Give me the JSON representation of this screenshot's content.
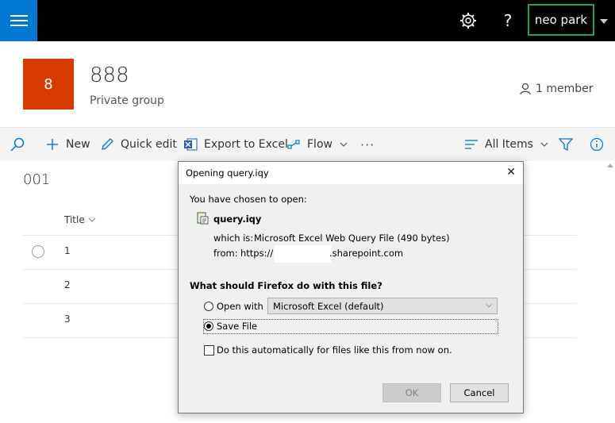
{
  "topbar": {
    "app_launcher_icon": "waffle-icon",
    "settings_icon": "gear-icon",
    "help": "?",
    "user_name": "neo park",
    "user_menu_icon": "caret-down-icon"
  },
  "group": {
    "tile_letter": "8",
    "tile_color": "#d83b01",
    "name": "888",
    "privacy": "Private group",
    "members": "1 member"
  },
  "commandbar": {
    "search_icon": "search-icon",
    "new": "New",
    "quick_edit": "Quick edit",
    "export": "Export to Excel",
    "flow": "Flow",
    "more": "···",
    "view": "All Items",
    "filter_icon": "filter-icon",
    "info_icon": "info-icon"
  },
  "list": {
    "name": "001",
    "column": "Title",
    "rows": [
      "1",
      "2",
      "3"
    ]
  },
  "dialog": {
    "title": "Opening query.iqy",
    "close": "✕",
    "chosen": "You have chosen to open:",
    "filename": "query.iqy",
    "which_is_label": "which is:",
    "which_is_value": "Microsoft Excel Web Query File (490 bytes)",
    "from_label": "from:",
    "from_prefix": "https://",
    "from_suffix": ".sharepoint.com",
    "question": "What should Firefox do with this file?",
    "open_with": "Open with",
    "open_with_app": "Microsoft Excel (default)",
    "save_file": "Save File",
    "auto": "Do this automatically for files like this from now on.",
    "ok": "OK",
    "cancel": "Cancel",
    "selected_option": "save_file"
  }
}
